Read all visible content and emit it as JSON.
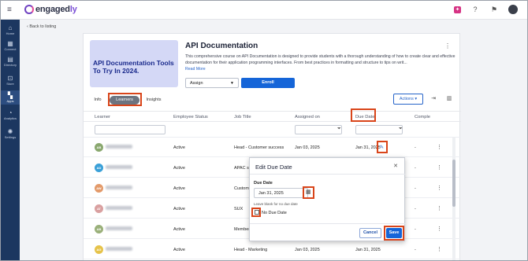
{
  "app": {
    "brand_main": "engaged",
    "brand_accent": "ly"
  },
  "sidebar": {
    "items": [
      {
        "label": "Home",
        "icon": "home-icon",
        "glyph": "⌂"
      },
      {
        "label": "Connect",
        "icon": "connect-icon",
        "glyph": "▦"
      },
      {
        "label": "Directory",
        "icon": "directory-icon",
        "glyph": "▤"
      },
      {
        "label": "Store",
        "icon": "store-icon",
        "glyph": "⊡"
      },
      {
        "label": "Apps",
        "icon": "apps-icon",
        "glyph": "▚"
      },
      {
        "label": "Analytics",
        "icon": "analytics-icon",
        "glyph": "◔"
      },
      {
        "label": "Settings",
        "icon": "settings-icon",
        "glyph": "✺"
      }
    ]
  },
  "topbar": {
    "icons": [
      "notification-icon",
      "help-icon",
      "flag-icon",
      "user-avatar"
    ]
  },
  "nav": {
    "back_label": "Back to listing"
  },
  "course": {
    "banner_text": "API Documentation Tools To Try In 2024.",
    "title": "API Documentation",
    "description": "This comprehensive course on API Documentation is designed to provide students with a thorough understanding of how to create clear and effective documentation for their application programming interfaces. From best practices in formatting and structure to tips on writ...",
    "read_more": "Read More",
    "assign_label": "Assign",
    "enroll_label": "Enroll"
  },
  "tabs": [
    "Info",
    "Learners",
    "Insights"
  ],
  "toolbar": {
    "actions_label": "Actions"
  },
  "table": {
    "columns": [
      "Learner",
      "Employee Status",
      "Job Title",
      "Assigned on",
      "Due Date",
      "Comple"
    ],
    "rows": [
      {
        "initials": "AB",
        "avatar_color": "#8aa86f",
        "status": "Active",
        "job": "Head - Customer success",
        "assigned": "Jan 03, 2025",
        "due": "Jan 31, 2025",
        "completion": "-"
      },
      {
        "initials": "AD",
        "avatar_color": "#3aa0d8",
        "status": "Active",
        "job": "APAC sal",
        "assigned": "",
        "due": "",
        "completion": "-"
      },
      {
        "initials": "AW",
        "avatar_color": "#e39a6a",
        "status": "Active",
        "job": "Custome",
        "assigned": "",
        "due": "",
        "completion": "-"
      },
      {
        "initials": "AT",
        "avatar_color": "#d9a0a0",
        "status": "Active",
        "job": "SUX",
        "assigned": "",
        "due": "",
        "completion": "-"
      },
      {
        "initials": "AB",
        "avatar_color": "#9ab07a",
        "status": "Active",
        "job": "Member",
        "assigned": "",
        "due": "",
        "completion": "-"
      },
      {
        "initials": "AG",
        "avatar_color": "#e6c34a",
        "status": "Active",
        "job": "Head - Marketing",
        "assigned": "Jan 03, 2025",
        "due": "Jan 31, 2025",
        "completion": "-"
      }
    ]
  },
  "modal": {
    "title": "Edit Due Date",
    "due_label": "Due Date",
    "date_value": "Jan 31, 2025",
    "helper": "Leave blank for no due date",
    "no_due_label": "No Due Date",
    "cancel_label": "Cancel",
    "save_label": "Save"
  },
  "colors": {
    "brand": "#1565d8",
    "sidebar": "#1c3760",
    "highlight": "#d9451a"
  }
}
